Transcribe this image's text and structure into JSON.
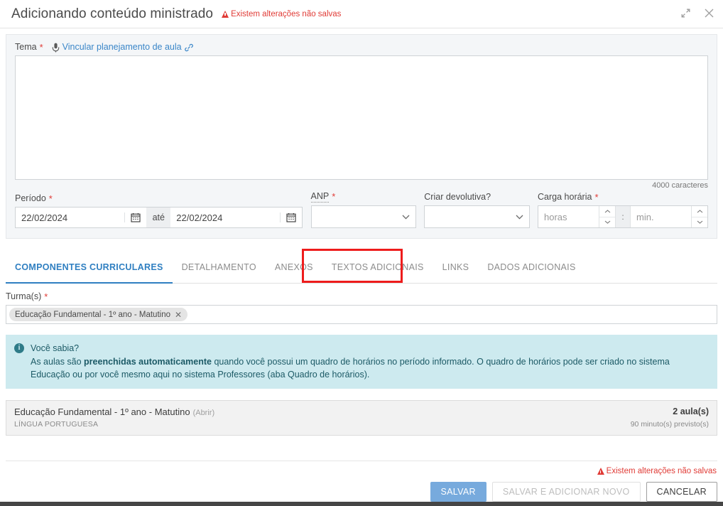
{
  "header": {
    "title": "Adicionando conteúdo ministrado",
    "unsaved_warning": "Existem alterações não salvas",
    "expand_icon": "expand-diagonal-icon",
    "close_icon": "close-icon"
  },
  "form": {
    "tema": {
      "label": "Tema",
      "required_mark": "*",
      "mic_icon": "microphone-icon",
      "link_label": "Vincular planejamento de aula",
      "link_icon": "chain-link-icon",
      "value": "",
      "counter": "4000 caracteres"
    },
    "periodo": {
      "label": "Período",
      "required_mark": "*",
      "start_value": "22/02/2024",
      "end_value": "22/02/2024",
      "separator": "até",
      "calendar_icon": "calendar-icon"
    },
    "anp": {
      "label": "ANP",
      "required_mark": "*",
      "value": "",
      "chevron_icon": "chevron-down-icon"
    },
    "devolutiva": {
      "label": "Criar devolutiva?",
      "value": "",
      "chevron_icon": "chevron-down-icon"
    },
    "carga_horaria": {
      "label": "Carga horária",
      "required_mark": "*",
      "hours_placeholder": "horas",
      "hours_value": "",
      "minutes_placeholder": "min.",
      "minutes_value": "",
      "separator": ":"
    }
  },
  "tabs": {
    "items": [
      {
        "label": "COMPONENTES CURRICULARES",
        "active": true
      },
      {
        "label": "DETALHAMENTO",
        "active": false
      },
      {
        "label": "ANEXOS",
        "active": false
      },
      {
        "label": "TEXTOS ADICIONAIS",
        "active": false
      },
      {
        "label": "LINKS",
        "active": false
      },
      {
        "label": "DADOS ADICIONAIS",
        "active": false
      }
    ],
    "highlight_tab": "TEXTOS ADICIONAIS",
    "highlight_color": "#ee1c1c"
  },
  "turmas": {
    "label": "Turma(s)",
    "required_mark": "*",
    "chips": [
      {
        "label": "Educação Fundamental - 1º ano - Matutino",
        "remove_icon": "close-icon"
      }
    ]
  },
  "info": {
    "icon": "info-circle-icon",
    "title": "Você sabia?",
    "text_part1": "As aulas são ",
    "text_bold": "preenchidas automaticamente",
    "text_part2": " quando você possui um quadro de horários no período informado. O quadro de horários pode ser criado no sistema Educação ou por você mesmo aqui no sistema Professores (aba Quadro de horários)."
  },
  "result_card": {
    "title": "Educação Fundamental - 1º ano - Matutino",
    "open_link": "(Abrir)",
    "subject": "LÍNGUA PORTUGUESA",
    "lessons_count": "2 aula(s)",
    "duration": "90 minuto(s) previsto(s)"
  },
  "footer": {
    "unsaved_warning": "Existem alterações não salvas",
    "save_label": "SALVAR",
    "save_add_label": "SALVAR E ADICIONAR NOVO",
    "cancel_label": "CANCELAR"
  },
  "colors": {
    "accent": "#2f7fc1",
    "primary_button": "#77aadd",
    "warning": "#e03b36",
    "info_bg": "#cdeaef",
    "annotation": "#ee1c1c"
  }
}
